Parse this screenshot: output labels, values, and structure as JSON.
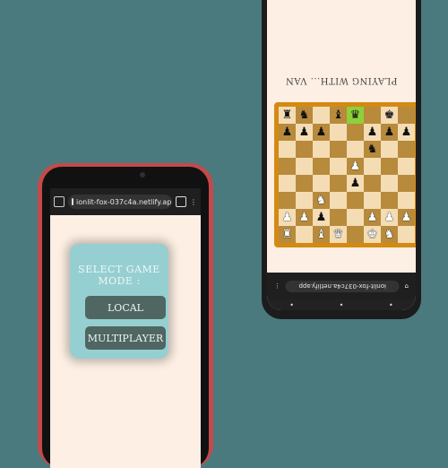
{
  "left_phone": {
    "url": "ionlit-fox-037c4a.netlify.app",
    "menu": {
      "title": "SELECT GAME MODE :",
      "local_label": "LOCAL",
      "multiplayer_label": "MULTIPLAYER"
    }
  },
  "right_phone": {
    "playing_text": "PLAYING WITH... VAN",
    "url": "ionlit-fox-037c4a.netlify.app",
    "board": {
      "rows": [
        [
          [
            "r",
            "b"
          ],
          [
            "n",
            "b"
          ],
          [
            "",
            ""
          ],
          [
            "b",
            "b"
          ],
          [
            "q",
            "b"
          ],
          [
            "",
            ""
          ],
          [
            "k",
            "b"
          ],
          [
            "",
            ""
          ]
        ],
        [
          [
            "p",
            "b"
          ],
          [
            "p",
            "b"
          ],
          [
            "p",
            "b"
          ],
          [
            "",
            ""
          ],
          [
            "",
            ""
          ],
          [
            "p",
            "b"
          ],
          [
            "p",
            "b"
          ],
          [
            "p",
            "b"
          ]
        ],
        [
          [
            "",
            ""
          ],
          [
            "",
            ""
          ],
          [
            "",
            ""
          ],
          [
            "",
            ""
          ],
          [
            "",
            ""
          ],
          [
            "n",
            "b"
          ],
          [
            "",
            ""
          ],
          [
            "",
            ""
          ]
        ],
        [
          [
            "",
            ""
          ],
          [
            "",
            ""
          ],
          [
            "",
            ""
          ],
          [
            "",
            ""
          ],
          [
            "p",
            "w"
          ],
          [
            "",
            ""
          ],
          [
            "",
            ""
          ],
          [
            "",
            ""
          ]
        ],
        [
          [
            "",
            ""
          ],
          [
            "",
            ""
          ],
          [
            "",
            ""
          ],
          [
            "",
            ""
          ],
          [
            "p",
            "b"
          ],
          [
            "",
            ""
          ],
          [
            "",
            ""
          ],
          [
            "",
            ""
          ]
        ],
        [
          [
            "",
            ""
          ],
          [
            "",
            ""
          ],
          [
            "n",
            "w"
          ],
          [
            "",
            ""
          ],
          [
            "",
            ""
          ],
          [
            "",
            ""
          ],
          [
            "",
            ""
          ],
          [
            "",
            ""
          ]
        ],
        [
          [
            "p",
            "w"
          ],
          [
            "p",
            "w"
          ],
          [
            "p",
            "b"
          ],
          [
            "",
            ""
          ],
          [
            "",
            ""
          ],
          [
            "p",
            "w"
          ],
          [
            "p",
            "w"
          ],
          [
            "p",
            "w"
          ]
        ],
        [
          [
            "r",
            "w"
          ],
          [
            "",
            ""
          ],
          [
            "b",
            "w"
          ],
          [
            "q",
            "w"
          ],
          [
            "",
            ""
          ],
          [
            "k",
            "w"
          ],
          [
            "n",
            "w"
          ],
          [
            "",
            ""
          ]
        ]
      ],
      "highlight": [
        0,
        4
      ]
    }
  }
}
